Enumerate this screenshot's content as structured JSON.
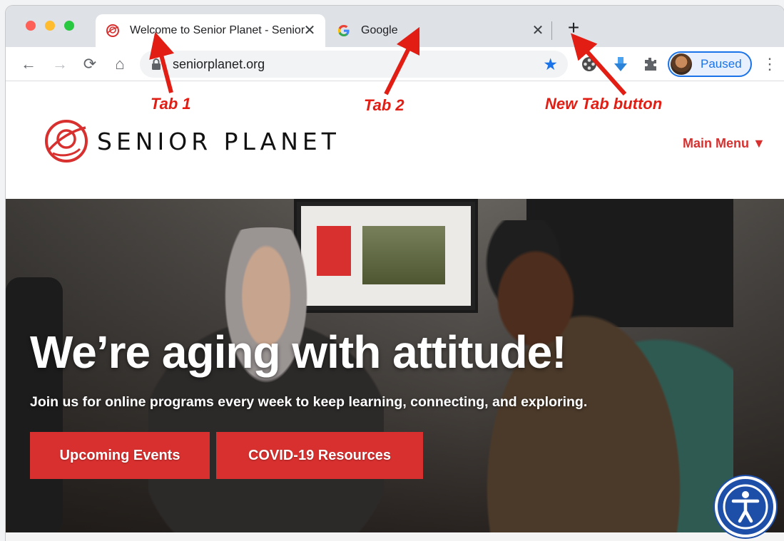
{
  "browser": {
    "tabs": [
      {
        "title": "Welcome to Senior Planet - Senior Planet",
        "favicon": "senior-planet-icon",
        "active": true
      },
      {
        "title": "Google",
        "favicon": "google-g-icon",
        "active": false
      }
    ],
    "close_glyph": "✕",
    "new_tab_glyph": "+",
    "url": "seniorplanet.org",
    "profile_label": "Paused",
    "nav": {
      "back": "←",
      "forward": "→",
      "reload": "⟳",
      "home": "⌂",
      "star": "★",
      "menu": "⋮"
    }
  },
  "site": {
    "logo_word1": "SENIOR",
    "logo_word2": "PLANET",
    "main_menu": "Main Menu ▼",
    "headline": "We’re aging with attitude!",
    "subhead": "Join us for online programs every week to keep learning, connecting, and exploring.",
    "buttons": {
      "events": "Upcoming Events",
      "covid": "COVID-19 Resources"
    }
  },
  "annotations": {
    "tab1": "Tab 1",
    "tab2": "Tab 2",
    "newtab": "New Tab button"
  },
  "colors": {
    "brand_red": "#d8302f",
    "annotation_red": "#e11d14",
    "chrome_blue": "#1a73e8"
  }
}
